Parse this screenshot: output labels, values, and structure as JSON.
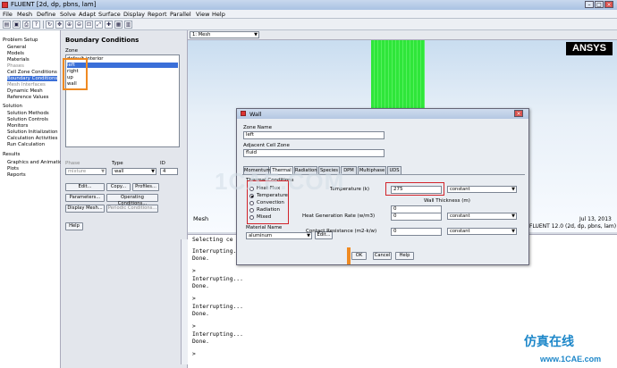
{
  "window": {
    "title": "FLUENT  [2d, dp, pbns, lam]"
  },
  "menu": [
    "File",
    "Mesh",
    "Define",
    "Solve",
    "Adapt",
    "Surface",
    "Display",
    "Report",
    "Parallel",
    "View",
    "Help"
  ],
  "tree": {
    "problem_setup": "Problem Setup",
    "items": [
      "General",
      "Models",
      "Materials",
      "Phases",
      "Cell Zone Conditions",
      "Boundary Conditions",
      "Mesh Interfaces",
      "Dynamic Mesh",
      "Reference Values"
    ],
    "solution": "Solution",
    "solution_items": [
      "Solution Methods",
      "Solution Controls",
      "Monitors",
      "Solution Initialization",
      "Calculation Activities",
      "Run Calculation"
    ],
    "results": "Results",
    "results_items": [
      "Graphics and Animations",
      "Plots",
      "Reports"
    ]
  },
  "bc": {
    "title": "Boundary Conditions",
    "zone_label": "Zone",
    "zones": [
      "default-interior",
      "left",
      "right",
      "up",
      "wall"
    ],
    "phase_label": "Phase",
    "phase_value": "mixture",
    "type_label": "Type",
    "type_value": "wall",
    "id_label": "ID",
    "id_value": "4",
    "edit": "Edit...",
    "copy": "Copy...",
    "profiles": "Profiles...",
    "parameters": "Parameters...",
    "operating": "Operating Conditions...",
    "display_mesh": "Display Mesh...",
    "periodic": "Periodic Conditions...",
    "help": "Help"
  },
  "viewport": {
    "selector": "1: Mesh",
    "mesh_label": "Mesh",
    "date": "Jul 13, 2013",
    "version": "FLUENT 12.0 (2d, dp, pbns, lam)",
    "logo": "ANSYS"
  },
  "console": [
    "Selecting ce",
    "Interrupting...",
    "Done.",
    ">",
    "Interrupting...",
    "Done.",
    ">",
    "Interrupting...",
    "Done.",
    ">",
    "Interrupting...",
    "Done.",
    ">"
  ],
  "dialog": {
    "title": "Wall",
    "zone_name_label": "Zone Name",
    "zone_name": "left",
    "adjacent_label": "Adjacent Cell Zone",
    "adjacent": "fluid",
    "tabs": [
      "Momentum",
      "Thermal",
      "Radiation",
      "Species",
      "DPM",
      "Multiphase",
      "UDS"
    ],
    "thermal_conditions_label": "Thermal Conditions",
    "options": [
      "Heat Flux",
      "Temperature",
      "Convection",
      "Radiation",
      "Mixed"
    ],
    "temperature_label": "Temperature (k)",
    "temperature_value": "275",
    "method": "constant",
    "wall_thickness_label": "Wall Thickness (m)",
    "wall_thickness_value": "0",
    "heat_gen_label": "Heat Generation Rate (w/m3)",
    "heat_gen_value": "0",
    "material_label": "Material Name",
    "material_value": "aluminum",
    "edit": "Edit...",
    "contact_label": "Contact Resistance (m2-k/w)",
    "contact_value": "0",
    "ok": "OK",
    "cancel": "Cancel",
    "help": "Help"
  },
  "watermark": {
    "text": "1CAE.COM",
    "cn": "仿真在线",
    "url": "www.1CAE.com"
  },
  "colors": {
    "highlight": "#3a6fd8",
    "red_box": "#d2232a",
    "orange_box": "#ef8a22",
    "mesh": "#2fe63a"
  }
}
